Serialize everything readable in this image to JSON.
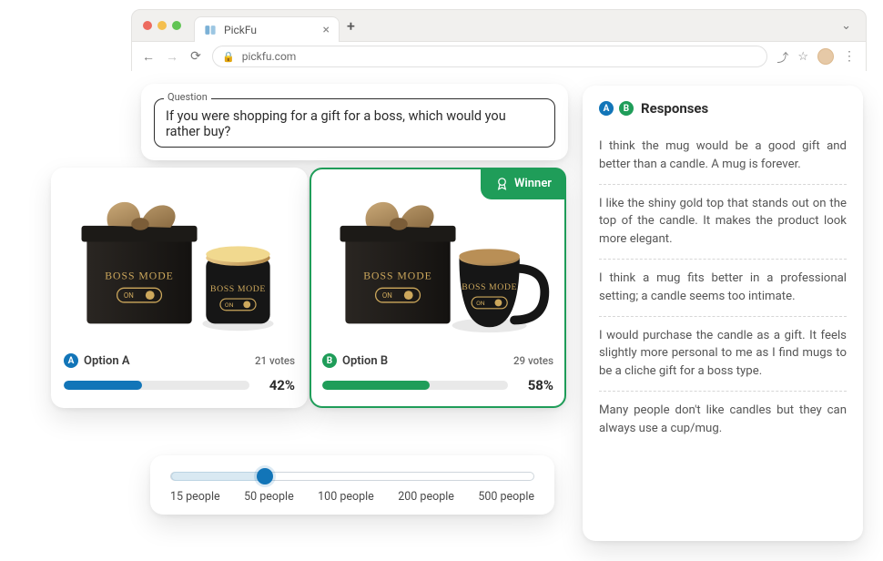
{
  "browser": {
    "tab_title": "PickFu",
    "url": "pickfu.com"
  },
  "question": {
    "label": "Question",
    "text": "If you were shopping for a gift for a boss, which would you rather buy?"
  },
  "options": {
    "a": {
      "badge": "A",
      "label": "Option A",
      "votes": "21 votes",
      "percent": "42%"
    },
    "b": {
      "badge": "B",
      "label": "Option B",
      "votes": "29 votes",
      "percent": "58%",
      "winner": "Winner"
    }
  },
  "slider": {
    "ticks": [
      "15 people",
      "50 people",
      "100 people",
      "200 people",
      "500 people"
    ],
    "selected_index": 1
  },
  "responses": {
    "title": "Responses",
    "badges": [
      "A",
      "B"
    ],
    "items": [
      "I think the mug would be a good gift and better than a candle. A mug is forever.",
      "I like the shiny gold top that stands out on the top of the candle. It makes the product look more elegant.",
      "I think a mug fits better in a professional setting; a candle seems too intimate.",
      "I would purchase the candle as a gift. It feels slightly more personal to me as I find mugs to be a cliche gift for a boss type.",
      "Many people don't like candles but they can always use a cup/mug."
    ]
  },
  "product_label": {
    "line1": "BOSS MODE",
    "line2": "ON"
  }
}
